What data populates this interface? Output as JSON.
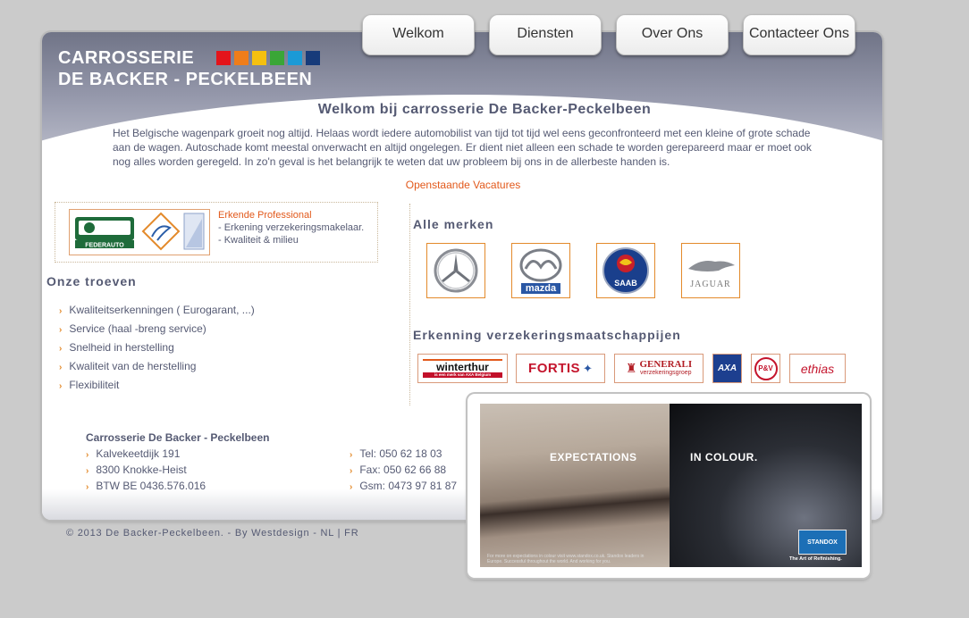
{
  "header": {
    "logo_line1": "CARROSSERIE",
    "logo_line2": "DE BACKER - PECKELBEEN",
    "logo_colors": [
      "#e4141b",
      "#ef7d1a",
      "#f5c00f",
      "#3aa637",
      "#1b9ad6",
      "#173b7a"
    ]
  },
  "nav": {
    "tabs": [
      {
        "label": "Welkom"
      },
      {
        "label": "Diensten"
      },
      {
        "label": "Over Ons"
      },
      {
        "label": "Contacteer Ons"
      }
    ]
  },
  "main": {
    "title": "Welkom bij carrosserie De Backer-Peckelbeen",
    "intro": "Het Belgische wagenpark groeit nog altijd. Helaas wordt iedere automobilist van tijd tot tijd wel eens geconfronteerd met een kleine of grote schade aan de wagen. Autoschade komt meestal onverwacht en altijd ongelegen. Er dient niet alleen een schade te worden gerepareerd maar er moet ook nog alles worden geregeld. In zo'n geval is het belangrijk te weten dat uw probleem bij ons in de allerbeste handen is.",
    "vacatures_link": "Openstaande Vacatures"
  },
  "erkend": {
    "title": "Erkende Professional",
    "items": [
      "- Erkening verzekeringsmakelaar.",
      "- Kwaliteit & milieu"
    ],
    "logo_text": "FEDERAUTO"
  },
  "troeven": {
    "title": "Onze troeven",
    "items": [
      "Kwaliteitserkenningen ( Eurogarant, ...)",
      "Service (haal -breng service)",
      "Snelheid in herstelling",
      "Kwaliteit van de herstelling",
      "Flexibiliteit"
    ]
  },
  "merken": {
    "title": "Alle merken",
    "brands": [
      {
        "name": "mercedes",
        "label": ""
      },
      {
        "name": "mazda",
        "label": "mazda"
      },
      {
        "name": "saab",
        "label": "SAAB"
      },
      {
        "name": "jaguar",
        "label": "JAGUAR"
      }
    ]
  },
  "verzekering": {
    "title": "Erkenning verzekeringsmaatschappijen",
    "companies": [
      {
        "label": "winterthur",
        "sub": "is een merk van AXA Belgium"
      },
      {
        "label": "FORTIS"
      },
      {
        "label": "GENERALI",
        "sub": "verzekeringsgroep"
      },
      {
        "label": "AXA"
      },
      {
        "label": "P&V"
      },
      {
        "label": "ethias"
      }
    ]
  },
  "contact": {
    "company": "Carrosserie De Backer - Peckelbeen",
    "address": [
      "Kalvekeetdijk 191",
      "8300 Knokke-Heist",
      "BTW BE 0436.576.016"
    ],
    "phones": [
      "Tel: 050 62 18 03",
      "Fax: 050 62 66 88",
      "Gsm: 0473 97 81 87"
    ]
  },
  "footer": {
    "copyright": "© 2013 De Backer-Peckelbeen. - By Westdesign - NL | FR"
  },
  "ad": {
    "left_text": "EXPECTATIONS",
    "right_text": "IN COLOUR.",
    "fine_print": "For more on expectations in colour visit www.standox.co.uk. Standox leaders in Europe. Successful throughout the world. And working for you.",
    "brand": "STANDOX",
    "tagline": "The Art of Refinishing."
  },
  "colors": {
    "accent_orange": "#e2591b",
    "text_slate": "#555a73",
    "bullet_orange": "#e38a2b"
  }
}
